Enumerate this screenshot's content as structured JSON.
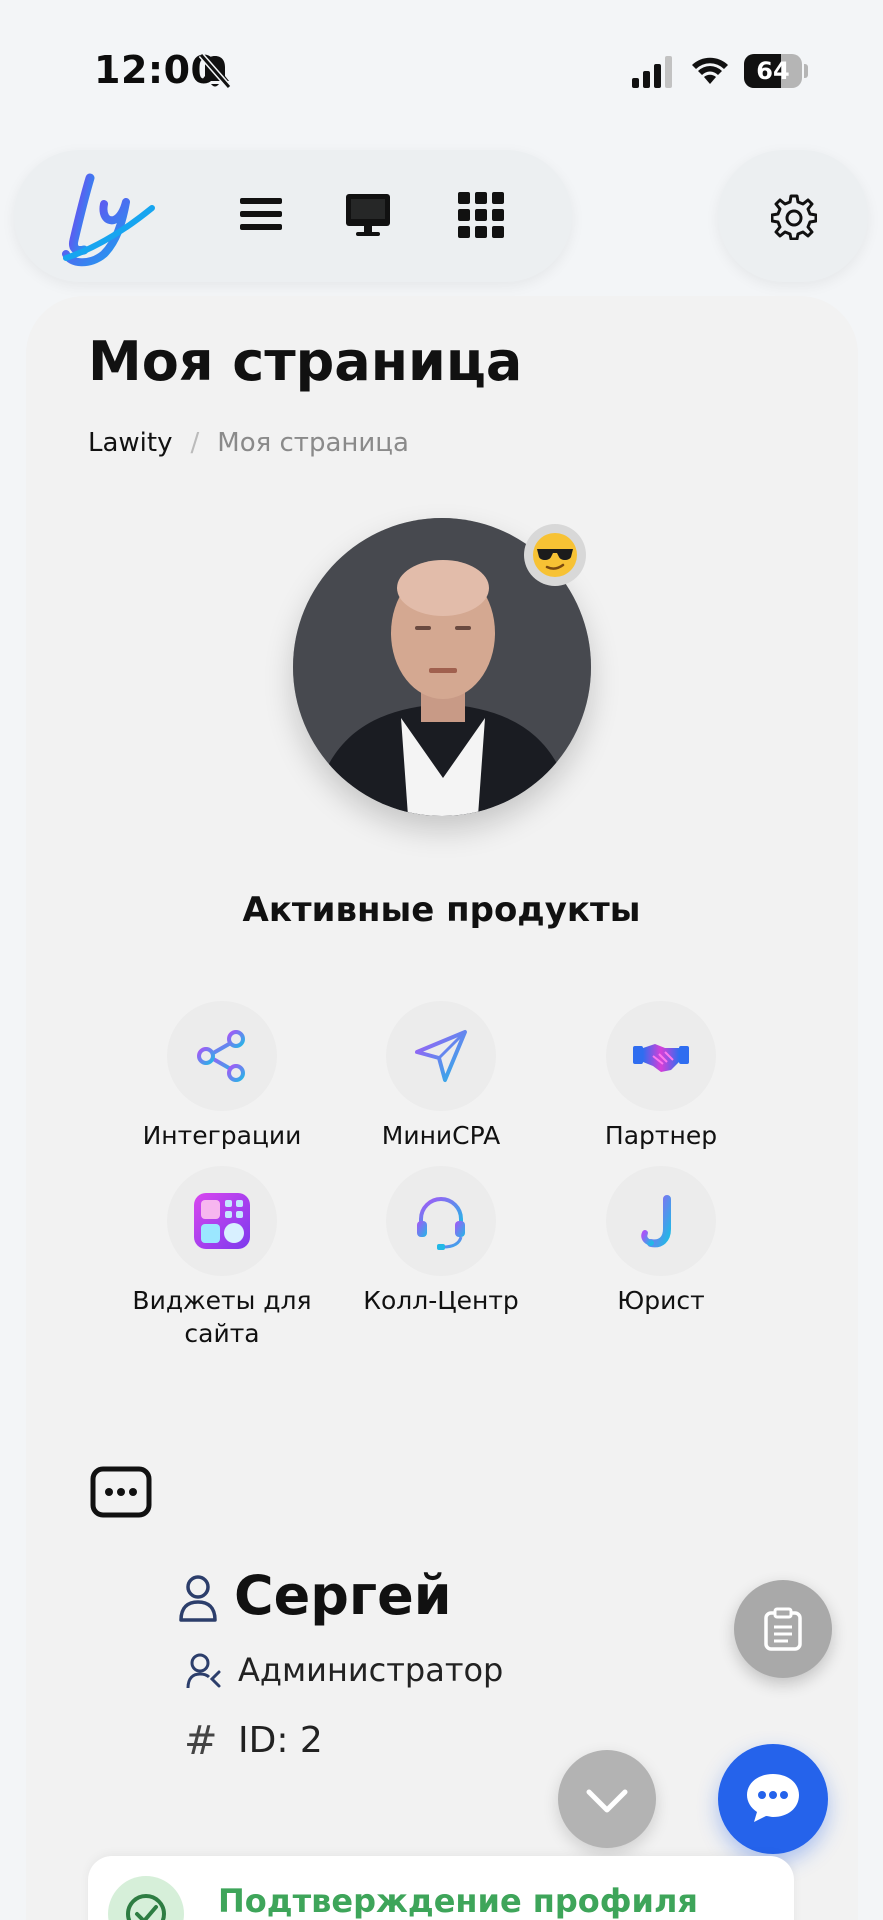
{
  "status_bar": {
    "time": "12:00",
    "battery": "64",
    "battery_level": 0.64
  },
  "nav": {
    "logo_text": "Ly"
  },
  "page": {
    "title": "Моя страница",
    "breadcrumb": {
      "home": "Lawity",
      "separator": "/",
      "current": "Моя страница"
    }
  },
  "products": {
    "title": "Активные продукты",
    "items": [
      {
        "label": "Интеграции",
        "icon": "share-icon"
      },
      {
        "label": "МиниCPA",
        "icon": "navigation-arrow-icon"
      },
      {
        "label": "Партнер",
        "icon": "handshake-icon"
      },
      {
        "label": "Виджеты для сайта",
        "icon": "widgets-icon"
      },
      {
        "label": "Колл-Центр",
        "icon": "headset-icon"
      },
      {
        "label": "Юрист",
        "icon": "letter-j-icon"
      }
    ]
  },
  "profile": {
    "name": "Сергей",
    "role": "Администратор",
    "id_text": "ID: 2"
  },
  "verification": {
    "title": "Подтверждение профиля"
  },
  "colors": {
    "accent": "#2563eb",
    "success": "#3ea55a",
    "background": "#f3f5f7"
  }
}
